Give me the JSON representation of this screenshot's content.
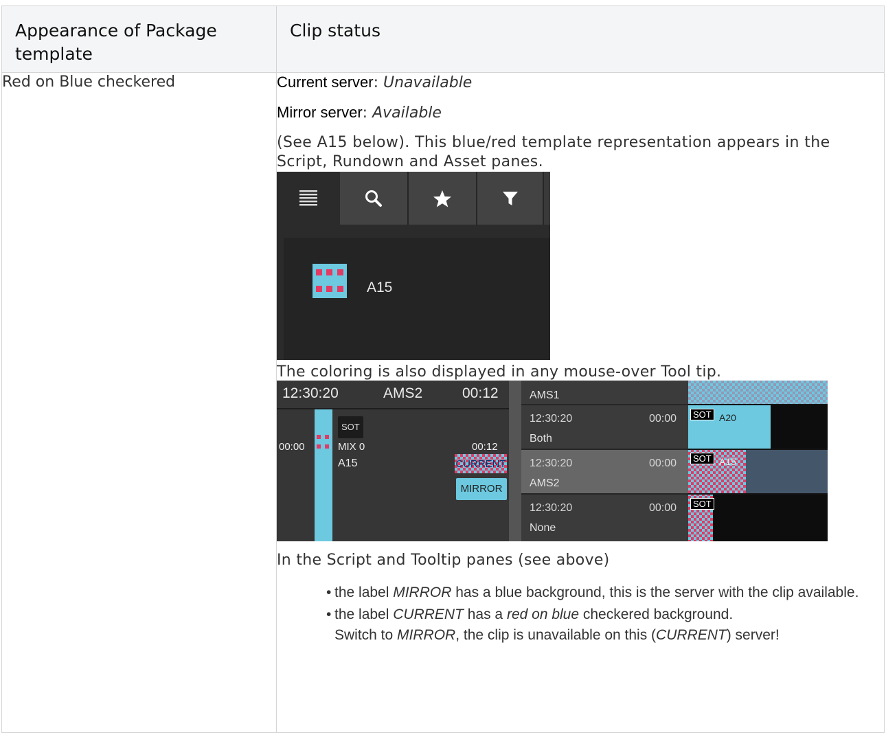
{
  "table": {
    "headers": [
      "Appearance of Package template",
      "Clip status"
    ],
    "row": {
      "appearance": "Red on Blue checkered",
      "current_server": {
        "label": "Current server",
        "sep": ": ",
        "value": "Unavailable"
      },
      "mirror_server": {
        "label": "Mirror server",
        "sep": ": ",
        "value": "Available"
      },
      "intro": "(See A15 below). This blue/red template representation appears in the Script, Rundown and Asset panes.",
      "coloring_note": "The coloring is also displayed in any mouse-over Tool tip.",
      "script_note": "In the Script and Tooltip panes (see above)",
      "bullets": [
        {
          "a": "the label ",
          "b": "MIRROR",
          "c": " has a blue background, this is the server with the clip available."
        },
        {
          "a": "the label ",
          "b": "CURRENT",
          "c": " has a ",
          "d": "red on blue",
          "e": " checkered background.",
          "f": "Switch to ",
          "g": "MIRROR",
          "h": ", the clip is unavailable on this (",
          "i": "CURRENT",
          "j": ") server!"
        }
      ]
    }
  },
  "asset_pane": {
    "tabs": [
      "list-icon",
      "search-icon",
      "star-icon",
      "filter-icon"
    ],
    "asset_name": "A15"
  },
  "tooltip_pane": {
    "left_header": {
      "time": "12:30:20",
      "server": "AMS2",
      "duration": "00:12"
    },
    "sot": "SOT",
    "left_time": "00:00",
    "mix": "MIX 0",
    "mix_duration": "00:12",
    "clip": "A15",
    "current_label": "CURRENT",
    "mirror_label": "MIRROR",
    "rows": [
      {
        "time": "",
        "duration": "",
        "server": "AMS1"
      },
      {
        "time": "12:30:20",
        "duration": "00:00",
        "server": "Both"
      },
      {
        "time": "12:30:20",
        "duration": "00:00",
        "server": "AMS2"
      },
      {
        "time": "12:30:20",
        "duration": "00:00",
        "server": "None"
      }
    ],
    "timeline": {
      "sot": "SOT",
      "clip_a20": "A20",
      "clip_a15": "A15"
    }
  },
  "colors": {
    "blue": "#6cc9e0",
    "red": "#e23a64",
    "pane_bg": "#2b2b2b"
  }
}
